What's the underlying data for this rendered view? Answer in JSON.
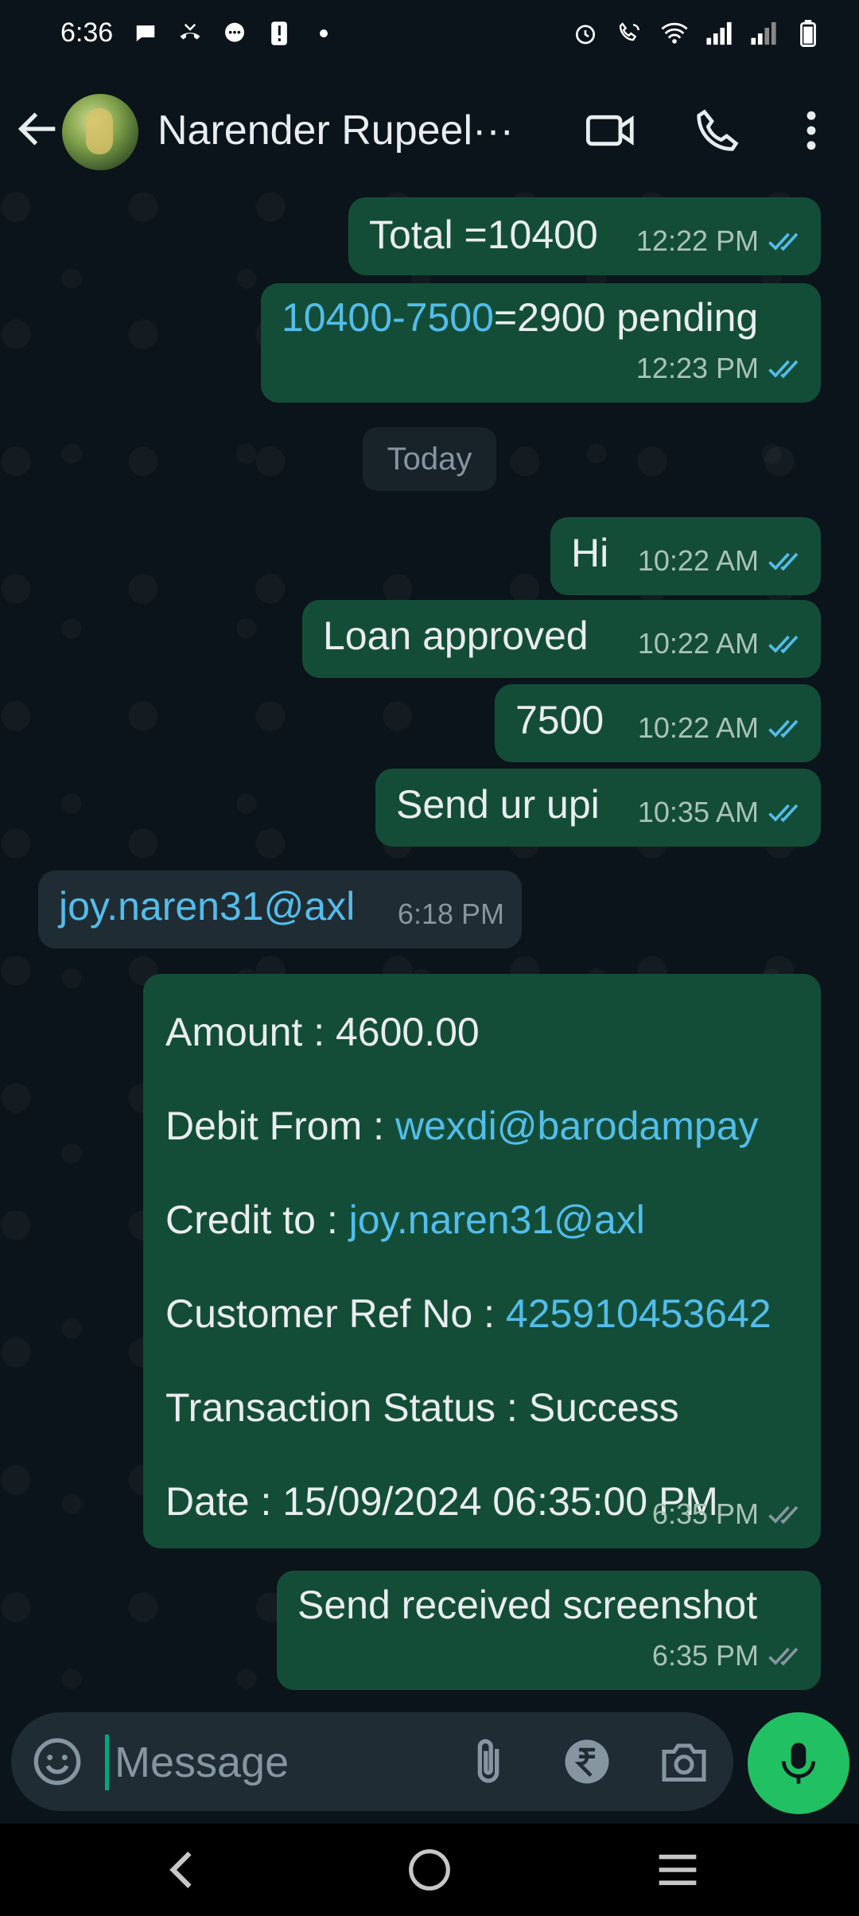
{
  "status_bar": {
    "time": "6:36"
  },
  "header": {
    "contact_name": "Narender Rupeel···"
  },
  "messages": [
    {
      "text": "Total =10400",
      "time": "12:22 PM"
    },
    {
      "link": "10400-7500",
      "text": "=2900 pending",
      "time": "12:23 PM"
    },
    {
      "text": "Hi",
      "time": "10:22 AM"
    },
    {
      "text": "Loan approved",
      "time": "10:22 AM"
    },
    {
      "text": "7500",
      "time": "10:22 AM"
    },
    {
      "text": "Send ur upi",
      "time": "10:35 AM"
    },
    {
      "text": "joy.naren31@axl",
      "time": "6:18 PM"
    },
    {
      "text": "Send received screenshot",
      "time": "6:35 PM"
    }
  ],
  "date_divider": "Today",
  "transaction": {
    "amount_label": "Amount : ",
    "amount": "4600.00",
    "debit_label": "Debit From : ",
    "debit": "wexdi@barodampay",
    "credit_label": "Credit to : ",
    "credit": "joy.naren31@axl",
    "ref_label": "Customer Ref No : ",
    "ref": "425910453642",
    "status_label": "Transaction Status : ",
    "status": "Success",
    "date_label": "Date : ",
    "date": "15/09/2024 06:35:00 PM",
    "time": "6:35 PM"
  },
  "composer": {
    "placeholder": "Message"
  },
  "colors": {
    "outgoing": "#144d37",
    "incoming": "#202c33",
    "link": "#53bdeb",
    "accent": "#21c063",
    "read_tick": "#53bdeb",
    "delivered_tick": "#8696a0"
  },
  "icons": [
    "back-arrow-icon",
    "video-call-icon",
    "phone-icon",
    "more-options-icon",
    "emoji-icon",
    "attach-icon",
    "rupee-icon",
    "camera-icon",
    "mic-icon"
  ]
}
